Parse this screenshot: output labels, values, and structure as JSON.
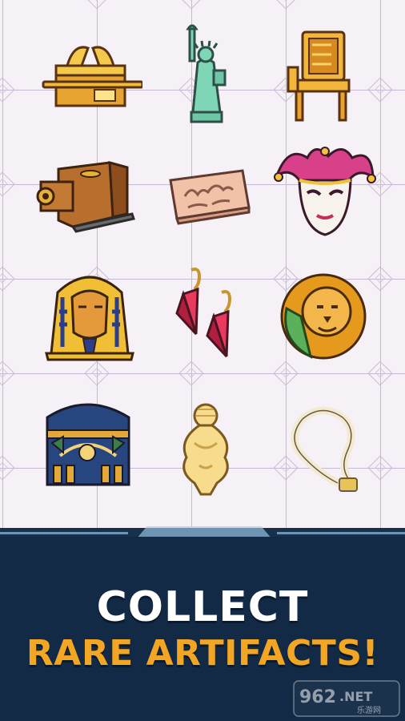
{
  "headline": {
    "line1": "COLLECT",
    "line2": "RARE ARTIFACTS!"
  },
  "colors": {
    "banner_bg": "#122a45",
    "headline_white": "#ffffff",
    "headline_orange": "#f3a623",
    "grid_bg": "#f6f1f7",
    "grid_line": "#c7b8d3"
  },
  "artifacts": [
    {
      "name": "ark-of-the-covenant-icon"
    },
    {
      "name": "statue-of-liberty-icon"
    },
    {
      "name": "golden-throne-icon"
    },
    {
      "name": "antique-camera-icon"
    },
    {
      "name": "stone-relief-tablet-icon"
    },
    {
      "name": "venetian-mask-icon"
    },
    {
      "name": "pharaoh-mask-icon"
    },
    {
      "name": "crystal-earrings-icon"
    },
    {
      "name": "lion-head-icon"
    },
    {
      "name": "egyptian-mural-icon"
    },
    {
      "name": "venus-figurine-icon"
    },
    {
      "name": "pearl-necklace-icon"
    }
  ],
  "watermark": {
    "brand": "962",
    "suffix": ".NET",
    "subtitle": "乐游网"
  }
}
